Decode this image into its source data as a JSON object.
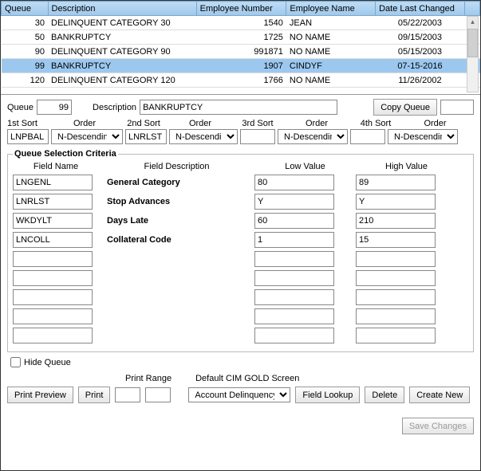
{
  "columns": {
    "queue": "Queue",
    "desc": "Description",
    "emp": "Employee Number",
    "name": "Employee Name",
    "date": "Date Last Changed"
  },
  "rows": [
    {
      "queue": "30",
      "desc": "DELINQUENT CATEGORY 30",
      "emp": "1540",
      "name": "JEAN",
      "date": "05/22/2003"
    },
    {
      "queue": "50",
      "desc": "BANKRUPTCY",
      "emp": "1725",
      "name": "NO NAME",
      "date": "09/15/2003"
    },
    {
      "queue": "90",
      "desc": "DELINQUENT CATEGORY 90",
      "emp": "991871",
      "name": "NO NAME",
      "date": "05/15/2003"
    },
    {
      "queue": "99",
      "desc": "BANKRUPTCY",
      "emp": "1907",
      "name": "CINDYF",
      "date": "07-15-2016"
    },
    {
      "queue": "120",
      "desc": "DELINQUENT CATEGORY 120",
      "emp": "1766",
      "name": "NO NAME",
      "date": "11/26/2002"
    }
  ],
  "selected_index": 3,
  "form": {
    "queue_label": "Queue",
    "queue_value": "99",
    "desc_label": "Description",
    "desc_value": "BANKRUPTCY",
    "copy_btn": "Copy Queue",
    "copy_value": ""
  },
  "sort": {
    "hdr_sort1": "1st Sort",
    "hdr_sort2": "2nd Sort",
    "hdr_sort3": "3rd Sort",
    "hdr_sort4": "4th  Sort",
    "hdr_order": "Order",
    "s1": "LNPBAL",
    "o1": "N-Descending",
    "s2": "LNRLST",
    "o2": "N-Descending",
    "s3": "",
    "o3": "N-Descending",
    "s4": "",
    "o4": "N-Descending"
  },
  "criteria": {
    "legend": "Queue Selection Criteria",
    "hdr_field": "Field Name",
    "hdr_desc": "Field Description",
    "hdr_low": "Low Value",
    "hdr_high": "High Value",
    "rows": [
      {
        "fn": "LNGENL",
        "fd": "General Category",
        "lv": "80",
        "hv": "89"
      },
      {
        "fn": "LNRLST",
        "fd": "Stop Advances",
        "lv": "Y",
        "hv": "Y"
      },
      {
        "fn": "WKDYLT",
        "fd": "Days Late",
        "lv": "60",
        "hv": "210"
      },
      {
        "fn": "LNCOLL",
        "fd": "Collateral Code",
        "lv": "1",
        "hv": "15"
      },
      {
        "fn": "",
        "fd": "",
        "lv": "",
        "hv": ""
      },
      {
        "fn": "",
        "fd": "",
        "lv": "",
        "hv": ""
      },
      {
        "fn": "",
        "fd": "",
        "lv": "",
        "hv": ""
      },
      {
        "fn": "",
        "fd": "",
        "lv": "",
        "hv": ""
      },
      {
        "fn": "",
        "fd": "",
        "lv": "",
        "hv": ""
      }
    ]
  },
  "bottom": {
    "hide_queue": "Hide Queue",
    "print_range": "Print Range",
    "default_screen": "Default CIM GOLD Screen",
    "print_preview": "Print Preview",
    "print": "Print",
    "pr1": "",
    "pr2": "",
    "screen_sel": "Account Delinquency",
    "field_lookup": "Field Lookup",
    "delete": "Delete",
    "create_new": "Create New",
    "save": "Save Changes"
  }
}
